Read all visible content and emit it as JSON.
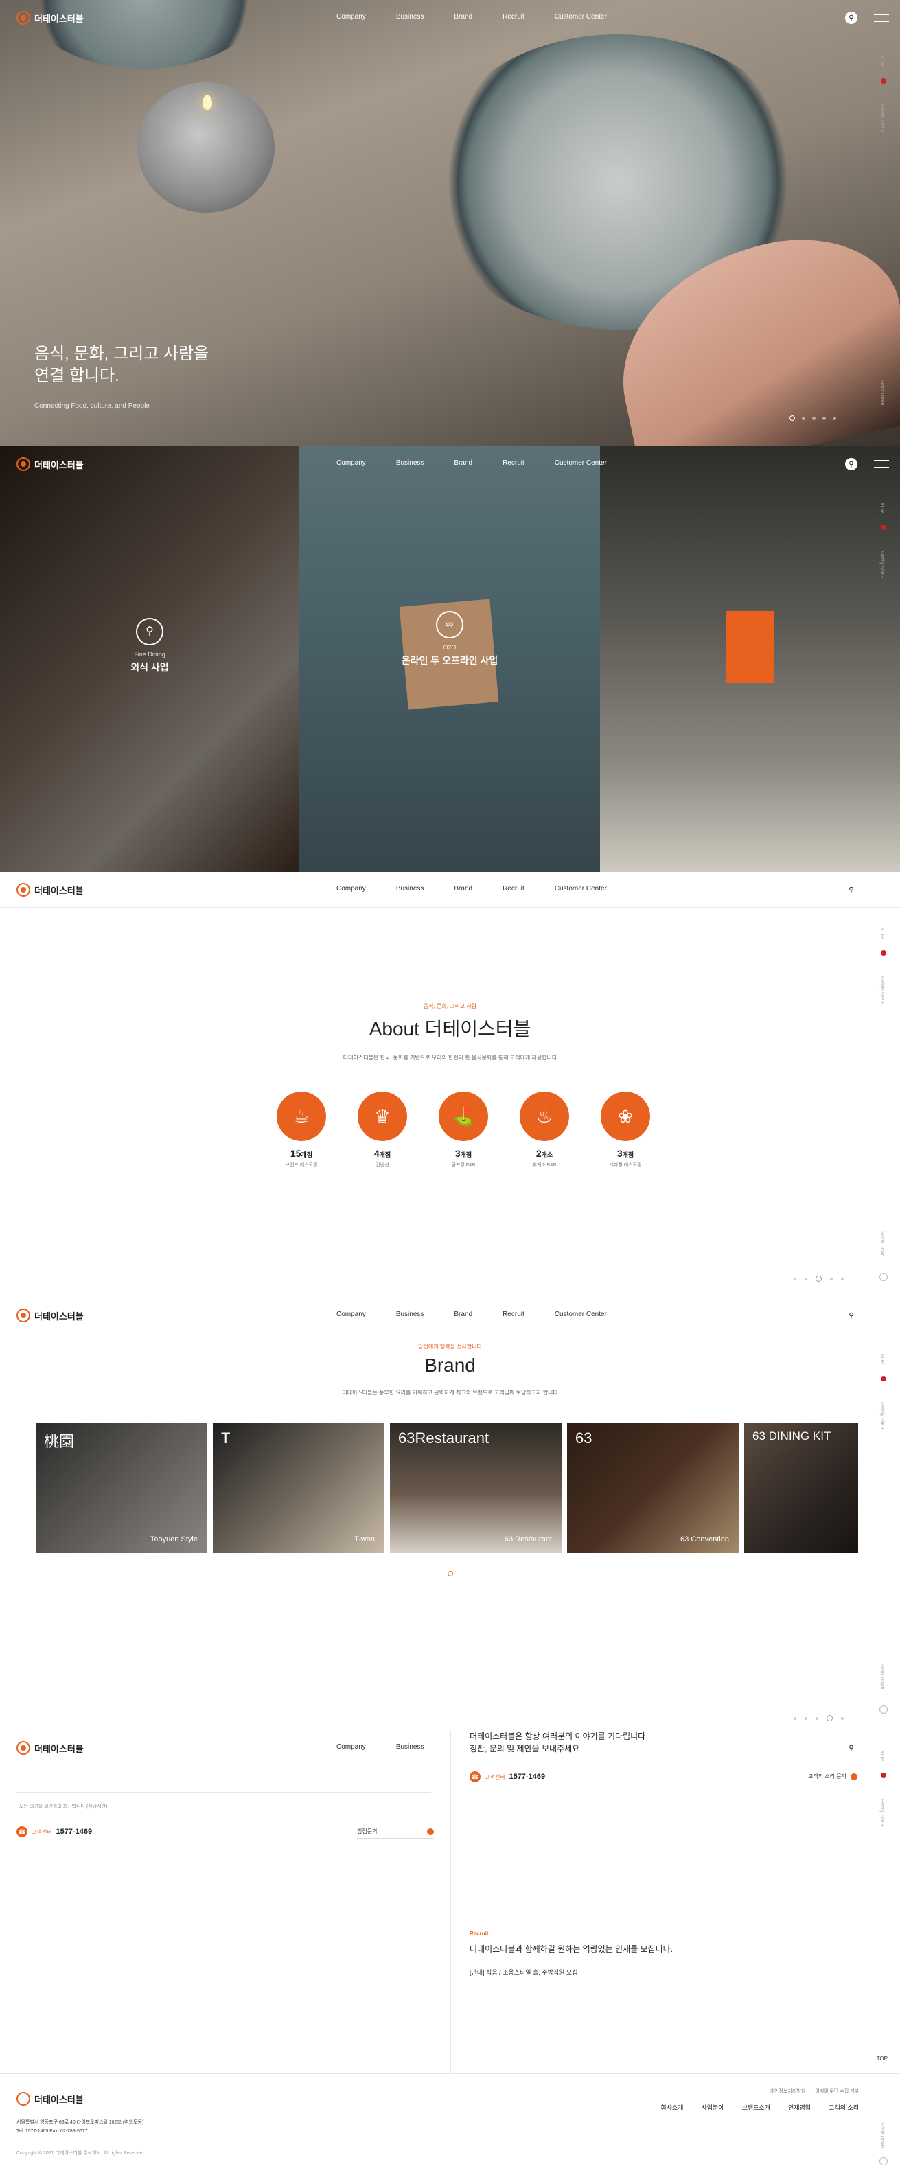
{
  "brand": {
    "logo_text": "더테이스터블",
    "accent": "#e8611f"
  },
  "nav": [
    "Company",
    "Business",
    "Brand",
    "Recruit",
    "Customer Center"
  ],
  "icons": {
    "search": "search-icon",
    "menu": "menu-icon"
  },
  "rail": {
    "lang": "KOR",
    "family": "Family Site +",
    "scroll": "Scroll Down"
  },
  "hero": {
    "title_line1": "음식, 문화, 그리고 사람을",
    "title_line2": "연결 합니다.",
    "subtitle": "Connecting Food, culture, and People"
  },
  "business": [
    {
      "en": "Fine Dining",
      "ko": "외식 사업"
    },
    {
      "en": "O2O",
      "ko": "온라인 투 오프라인 사업"
    }
  ],
  "about": {
    "kicker": "음식, 문화, 그리고 사람",
    "title": "About 더테이스터블",
    "desc": "더테이스터블은 한국, 문화를 기반으로 우리의 한턴과 한 음식문화를 통해 고객에게 제공합니다",
    "stats": [
      {
        "num": "15",
        "unit": "개점",
        "label": "브랜드 레스토랑"
      },
      {
        "num": "4",
        "unit": "개점",
        "label": "컨벤션"
      },
      {
        "num": "3",
        "unit": "개점",
        "label": "골프장 F&B"
      },
      {
        "num": "2",
        "unit": "개소",
        "label": "휴게소 F&B"
      },
      {
        "num": "3",
        "unit": "개점",
        "label": "테마형 레스토랑"
      }
    ]
  },
  "brand_sec": {
    "kicker": "당신에게 행복을 선사합니다",
    "title": "Brand",
    "desc": "더테이스터블는 풍부한 요리를 기획하고 완벽하게 최고의 브랜드로 고객님께 보답하고자 합니다",
    "cards": [
      {
        "title": "桃園",
        "caption": "Taoyuen Style"
      },
      {
        "title": "T",
        "caption": "T-won"
      },
      {
        "title": "63Restaurant",
        "caption": "63 Restaurant"
      },
      {
        "title": "63",
        "caption": "63 Convention"
      },
      {
        "title": "63 DINING KIT",
        "caption": ""
      }
    ]
  },
  "contact": {
    "top_line1": "더테이스터블은 항상 여러분의 이야기를 기다립니다",
    "top_line2": "칭찬, 문의 및 제안을 보내주세요",
    "tel_label": "고객센터",
    "tel_num": "1577-1469",
    "customer_voice": "고객의 소리 문의",
    "left_note": "모든 의견을 확인하고 회신합니다 (상담시간)",
    "left_btn": "입점문의",
    "recruit_kicker": "Recruit",
    "recruit_title": "더테이스터블과 함께하길 원하는 역량있는 인재를 모집니다.",
    "recruit_job": "[안내] 식음 / 조용스타일 홀, 주방직원 모집",
    "top": "TOP"
  },
  "footer": {
    "addr1": "서울특별시 영등포구 63로 40 라이프오피스텔 102호 (여의도동)",
    "addr2": "Tel. 1577-1469    Fax. 02-789-5677",
    "copy": "Copyright © 2021 더테이스터블 주식회사. All rights Reserved.",
    "sub": [
      "개인정보처리방침",
      "이메일 무단 수집 거부"
    ],
    "nav": [
      "회사소개",
      "사업분야",
      "브랜드소개",
      "인재영입",
      "고객의 소리"
    ]
  }
}
